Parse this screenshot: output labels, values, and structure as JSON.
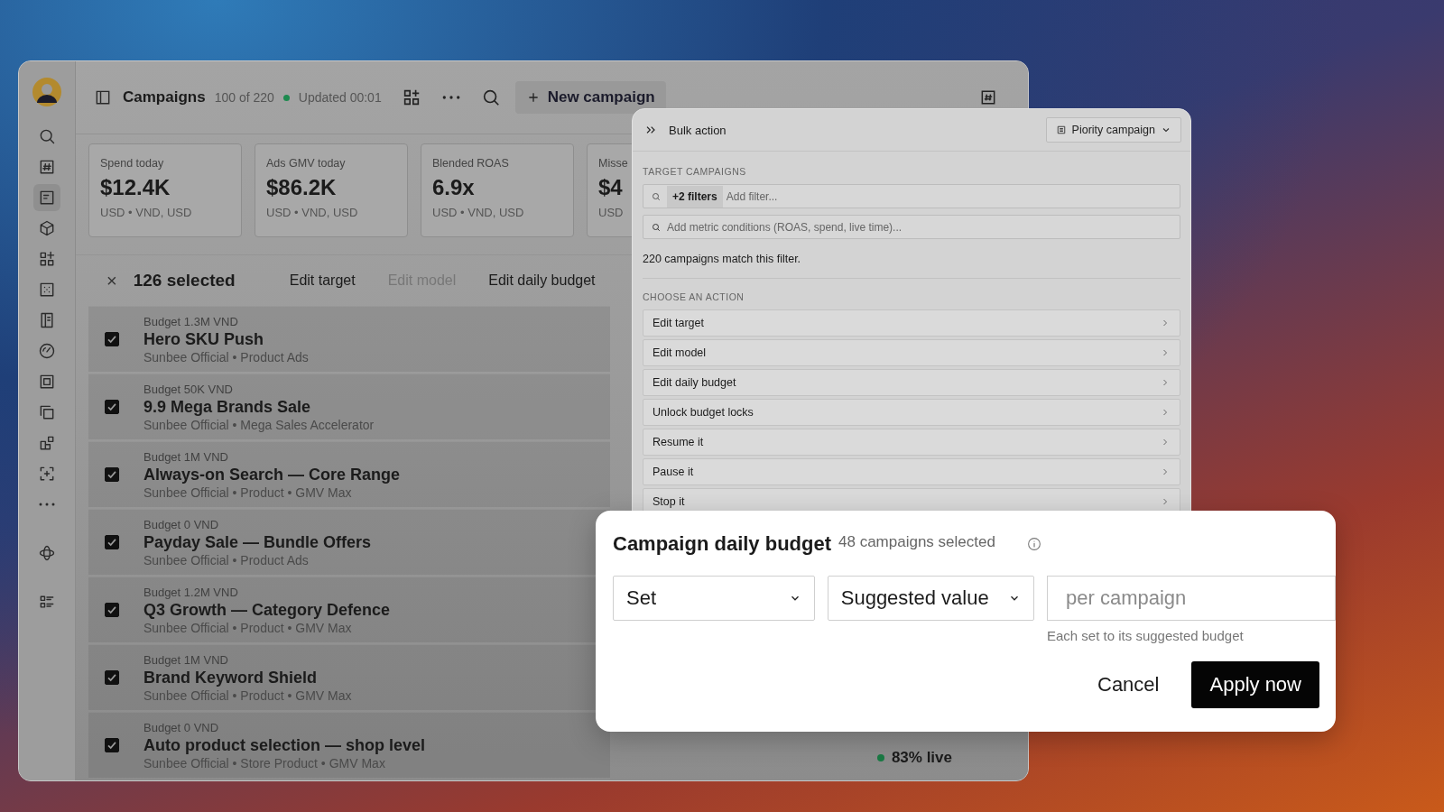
{
  "sidebar": {
    "items": [
      {
        "selected": false
      },
      {
        "selected": false
      },
      {
        "selected": true
      },
      {
        "selected": false
      },
      {
        "selected": false
      },
      {
        "selected": false
      },
      {
        "selected": false
      },
      {
        "selected": false
      },
      {
        "selected": false
      },
      {
        "selected": false
      },
      {
        "selected": false
      },
      {
        "selected": false
      },
      {
        "selected": false
      },
      {
        "selected": false
      },
      {
        "selected": false
      }
    ]
  },
  "header": {
    "title": "Campaigns",
    "count": "100 of 220",
    "status": "Updated 00:01",
    "new_button": "New campaign"
  },
  "metrics": [
    {
      "label": "Spend today",
      "value": "$12.4K",
      "note": "USD • VND, USD"
    },
    {
      "label": "Ads GMV today",
      "value": "$86.2K",
      "note": "USD • VND, USD"
    },
    {
      "label": "Blended ROAS",
      "value": "6.9x",
      "note": "USD • VND, USD"
    },
    {
      "label": "Misse",
      "value": "$4",
      "note": "USD"
    }
  ],
  "selection_bar": {
    "clear": "×",
    "count": "126 selected",
    "actions": [
      {
        "label": "Edit target",
        "disabled": false
      },
      {
        "label": "Edit model",
        "disabled": true
      },
      {
        "label": "Edit daily budget",
        "disabled": false
      }
    ]
  },
  "campaigns": [
    {
      "budget": "Budget 1.3M VND",
      "name": "Hero SKU Push",
      "subtitle": "Sunbee Official • Product Ads",
      "checked": true
    },
    {
      "budget": "Budget 50K VND",
      "name": "9.9 Mega Brands Sale",
      "subtitle": "Sunbee Official • Mega Sales Accelerator",
      "checked": true
    },
    {
      "budget": "Budget 1M VND",
      "name": "Always-on Search — Core Range",
      "subtitle": "Sunbee Official • Product • GMV Max",
      "checked": true
    },
    {
      "budget": "Budget 0 VND",
      "name": "Payday Sale — Bundle Offers",
      "subtitle": "Sunbee Official • Product Ads",
      "checked": true
    },
    {
      "budget": "Budget 1.2M VND",
      "name": "Q3 Growth — Category Defence",
      "subtitle": "Sunbee Official • Product • GMV Max",
      "checked": true
    },
    {
      "budget": "Budget 1M VND",
      "name": "Brand Keyword Shield",
      "subtitle": "Sunbee Official • Product • GMV Max",
      "checked": true
    },
    {
      "budget": "Budget 0 VND",
      "name": "Auto product selection — shop level",
      "subtitle": "Sunbee Official • Store Product • GMV Max",
      "checked": true,
      "live": "83% live"
    }
  ],
  "bulk_panel": {
    "title": "Bulk action",
    "preset": "Piority campaign",
    "target_heading": "TARGET CAMPAIGNS",
    "filter_chip": "+2 filters",
    "filter_placeholder": "Add filter...",
    "metric_placeholder": "Add metric conditions (ROAS, spend, live time)...",
    "match_text": "220 campaigns match this filter.",
    "action_heading": "CHOOSE AN ACTION",
    "actions": [
      "Edit target",
      "Edit model",
      "Edit daily budget",
      "Unlock budget locks",
      "Resume it",
      "Pause it",
      "Stop it"
    ]
  },
  "dialog": {
    "title": "Campaign daily budget",
    "subtitle": "48 campaigns selected",
    "mode": "Set",
    "value_source": "Suggested value",
    "amount_placeholder": "per campaign",
    "hint": "Each set to its suggested budget",
    "cancel": "Cancel",
    "apply": "Apply now"
  }
}
